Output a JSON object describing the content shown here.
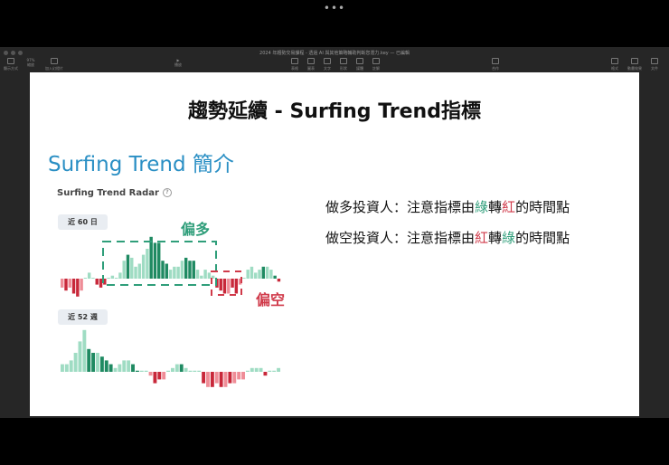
{
  "window": {
    "title": "2024 年趨勢交易課程 - 透過 AI 與其他策略輔助判斷您潛力.key — 已編輯",
    "zoom": "97%"
  },
  "toolbar": {
    "left": [
      "顯示方式",
      "縮放",
      "加入幻燈片"
    ],
    "play": "播放",
    "insert": [
      "表格",
      "圖表",
      "文字",
      "形狀",
      "媒體",
      "註解"
    ],
    "collab": "合作",
    "right": [
      "格式",
      "動畫效果",
      "文件"
    ]
  },
  "slide": {
    "title": "趨勢延續 - Surfing Trend指標",
    "subtitle": "Surfing Trend 簡介",
    "radar_title": "Surfing Trend Radar",
    "help": "?",
    "period1": "近 60 日",
    "period2": "近 52 週",
    "bull_label": "偏多",
    "bear_label": "偏空",
    "line1": {
      "a": "做多投資人：注意指標由",
      "b": "綠",
      "c": "轉",
      "d": "紅",
      "e": "的時間點"
    },
    "line2": {
      "a": "做空投資人：注意指標由",
      "b": "紅",
      "c": "轉",
      "d": "綠",
      "e": "的時間點"
    }
  },
  "colors": {
    "green_light": "#9fdcc3",
    "green_dark": "#1f8a62",
    "red_light": "#ef8d97",
    "red_dark": "#c8283a",
    "accent": "#2a8fc4"
  },
  "chart_data": [
    {
      "type": "bar",
      "title": "近 60 日",
      "values": [
        -3,
        -4,
        -3,
        -5,
        -6,
        -4,
        0,
        2,
        0,
        -2,
        -3,
        -2,
        0,
        1,
        0,
        2,
        6,
        8,
        7,
        4,
        5,
        8,
        10,
        14,
        12,
        12,
        6,
        5,
        3,
        4,
        4,
        6,
        7,
        6,
        6,
        3,
        1,
        3,
        2,
        1,
        -3,
        -4,
        -5,
        -5,
        -3,
        -5,
        -2,
        0,
        3,
        4,
        2,
        3,
        4,
        4,
        3,
        1,
        -1
      ],
      "strong": [
        0,
        1,
        0,
        1,
        1,
        0,
        0,
        0,
        0,
        1,
        1,
        1,
        0,
        0,
        0,
        0,
        0,
        1,
        0,
        0,
        0,
        0,
        0,
        1,
        1,
        1,
        1,
        1,
        0,
        0,
        0,
        0,
        1,
        1,
        1,
        0,
        0,
        0,
        0,
        0,
        1,
        1,
        1,
        0,
        1,
        1,
        0,
        0,
        0,
        0,
        0,
        0,
        1,
        0,
        0,
        1,
        1
      ]
    },
    {
      "type": "bar",
      "title": "近 52 週",
      "values": [
        2,
        2,
        3,
        5,
        8,
        11,
        6,
        5,
        5,
        4,
        3,
        2,
        1,
        2,
        3,
        3,
        2,
        0.3,
        0.3,
        0.3,
        -1,
        -3,
        -2,
        -2,
        0.3,
        1,
        2,
        2,
        1,
        0.3,
        0.3,
        0.3,
        -3,
        -4,
        -4,
        -3,
        -4,
        -4,
        -3,
        -3,
        -2,
        -2,
        0.3,
        1,
        1,
        1,
        -1,
        0.3,
        0.3,
        1
      ],
      "strong": [
        0,
        0,
        0,
        0,
        0,
        0,
        1,
        1,
        0,
        1,
        1,
        1,
        0,
        0,
        0,
        0,
        1,
        1,
        0,
        0,
        0,
        1,
        1,
        0,
        0,
        0,
        0,
        1,
        0,
        0,
        0,
        0,
        1,
        0,
        1,
        0,
        1,
        0,
        1,
        0,
        0,
        0,
        0,
        0,
        0,
        0,
        1,
        0,
        0,
        0
      ]
    }
  ]
}
